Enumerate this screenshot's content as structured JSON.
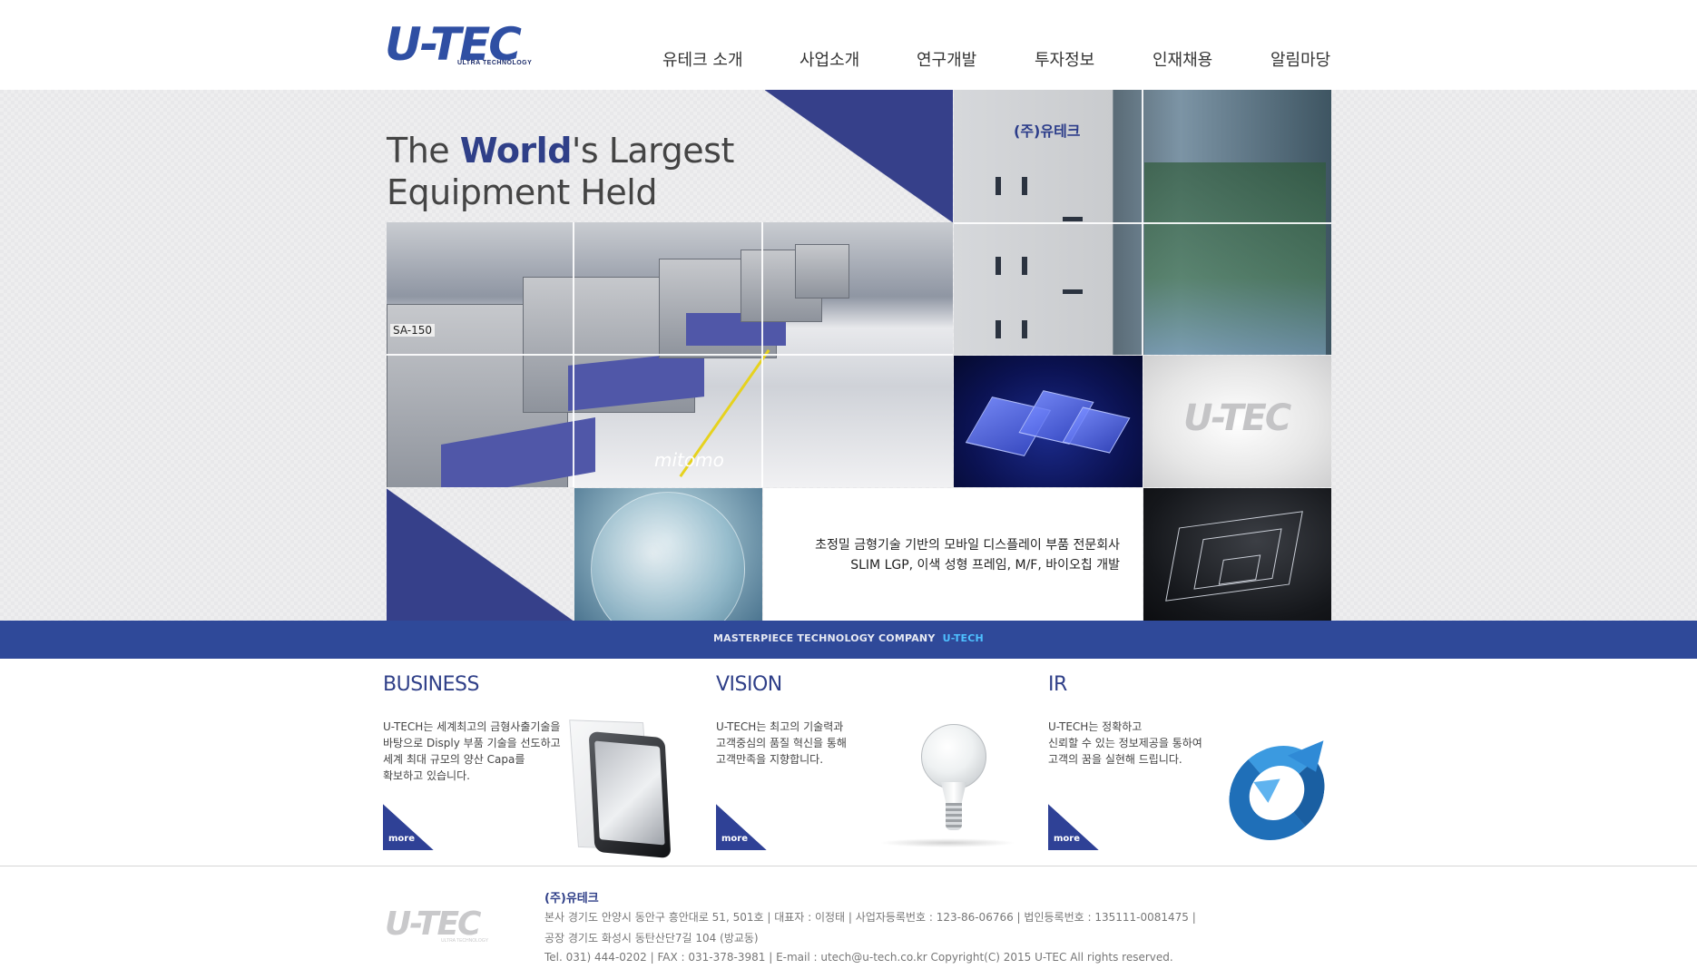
{
  "header": {
    "logo_text": "U-TEC",
    "logo_subtitle": "ULTRA TECHNOLOGY",
    "nav": [
      {
        "label": "유테크 소개"
      },
      {
        "label": "사업소개"
      },
      {
        "label": "연구개발"
      },
      {
        "label": "투자정보"
      },
      {
        "label": "인재채용"
      },
      {
        "label": "알림마당"
      }
    ]
  },
  "hero": {
    "headline_pre": "The ",
    "headline_highlight": "World",
    "headline_post": "'s Largest",
    "headline_line2": "Equipment Held",
    "building_sign": "(주)유테크",
    "logo_tile_text": "U-TEC",
    "tagline_1": "초정밀 금형기술 기반의 모바일 디스플레이 부품 전문회사",
    "tagline_2": "SLIM LGP, 이색 성형 프레임, M/F, 바이오칩 개발",
    "machine_label": "mitomo",
    "machine_tag": "SA-150"
  },
  "band": {
    "text": "MASTERPIECE TECHNOLOGY COMPANY",
    "highlight": "U-TECH"
  },
  "boxes": [
    {
      "title": "BUSINESS",
      "lines": [
        "U-TECH는 세계최고의 금형사출기술을",
        "바탕으로 Disply 부품 기술을 선도하고",
        "세계 최대 규모의 양산 Capa를",
        "확보하고 있습니다."
      ],
      "more": "more"
    },
    {
      "title": "VISION",
      "lines": [
        "U-TECH는 최고의 기술력과",
        "고객중심의 품질 혁신을 통해",
        "고객만족을 지향합니다."
      ],
      "more": "more"
    },
    {
      "title": "IR",
      "lines": [
        "U-TECH는 정확하고",
        "신뢰할 수 있는 정보제공을 통하여",
        "고객의 꿈을 실현해 드립니다."
      ],
      "more": "more"
    }
  ],
  "footer": {
    "logo_text": "U-TEC",
    "logo_subtitle": "ULTRA TECHNOLOGY",
    "company": "(주)유테크",
    "line1": "본사  경기도 안양시 동안구 흥안대로 51, 501호  |  대표자 : 이정태  |  사업자등록번호 : 123-86-06766  |  법인등록번호 : 135111-0081475  |",
    "line2": "공장  경기도 화성시 동탄산단7길 104 (방교동)",
    "line3": "Tel. 031) 444-0202  |  FAX : 031-378-3981  |  E-mail : utech@u-tech.co.kr   Copyright(C) 2015 U-TEC All rights reserved."
  },
  "colors": {
    "brand_navy": "#2f3f88",
    "band_blue": "#2f4999",
    "band_highlight": "#4ec0ff"
  }
}
